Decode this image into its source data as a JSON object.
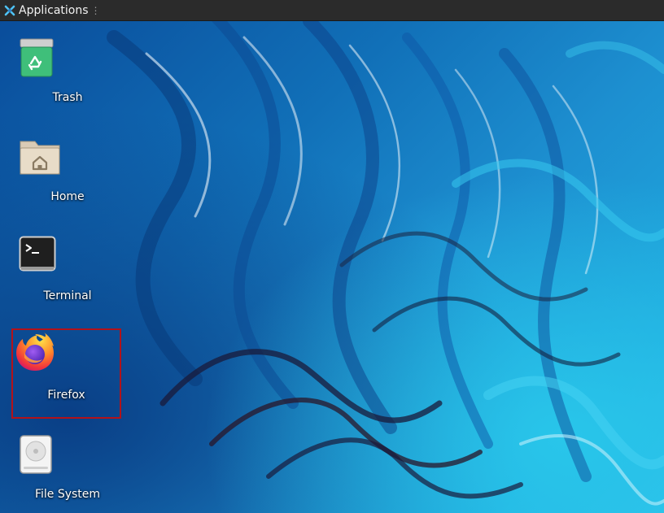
{
  "panel": {
    "menu_label": "Applications",
    "menu_indicator": "⋮",
    "background": "#2b2b2b"
  },
  "desktop": {
    "icons": [
      {
        "label": "Trash",
        "icon": "trash-icon",
        "selected": false
      },
      {
        "label": "Home",
        "icon": "home-folder-icon",
        "selected": false
      },
      {
        "label": "Terminal",
        "icon": "terminal-icon",
        "selected": false
      },
      {
        "label": "Firefox",
        "icon": "firefox-icon",
        "selected": true
      },
      {
        "label": "File System",
        "icon": "drive-icon",
        "selected": false
      }
    ],
    "selection_color": "#b3121a"
  }
}
